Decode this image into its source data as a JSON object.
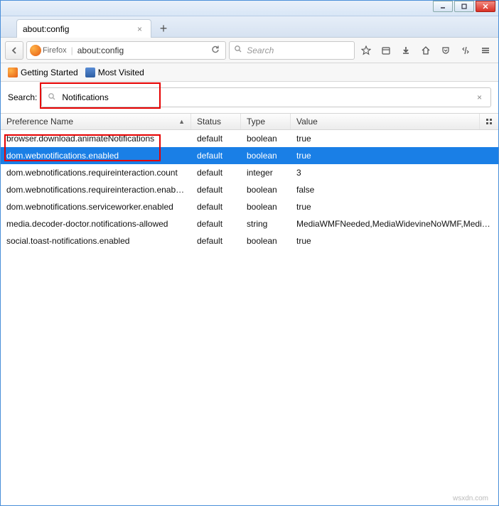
{
  "window": {
    "tab_title": "about:config",
    "url_brand": "Firefox",
    "url": "about:config",
    "search_placeholder": "Search"
  },
  "bookmarks": [
    {
      "label": "Getting Started"
    },
    {
      "label": "Most Visited"
    }
  ],
  "config": {
    "search_label": "Search:",
    "search_value": "Notifications",
    "columns": {
      "name": "Preference Name",
      "status": "Status",
      "type": "Type",
      "value": "Value"
    },
    "rows": [
      {
        "name": "browser.download.animateNotifications",
        "status": "default",
        "type": "boolean",
        "value": "true",
        "selected": false
      },
      {
        "name": "dom.webnotifications.enabled",
        "status": "default",
        "type": "boolean",
        "value": "true",
        "selected": true
      },
      {
        "name": "dom.webnotifications.requireinteraction.count",
        "status": "default",
        "type": "integer",
        "value": "3",
        "selected": false
      },
      {
        "name": "dom.webnotifications.requireinteraction.enabled",
        "status": "default",
        "type": "boolean",
        "value": "false",
        "selected": false
      },
      {
        "name": "dom.webnotifications.serviceworker.enabled",
        "status": "default",
        "type": "boolean",
        "value": "true",
        "selected": false
      },
      {
        "name": "media.decoder-doctor.notifications-allowed",
        "status": "default",
        "type": "string",
        "value": "MediaWMFNeeded,MediaWidevineNoWMF,Media...",
        "selected": false
      },
      {
        "name": "social.toast-notifications.enabled",
        "status": "default",
        "type": "boolean",
        "value": "true",
        "selected": false
      }
    ]
  },
  "watermark": "wsxdn.com"
}
